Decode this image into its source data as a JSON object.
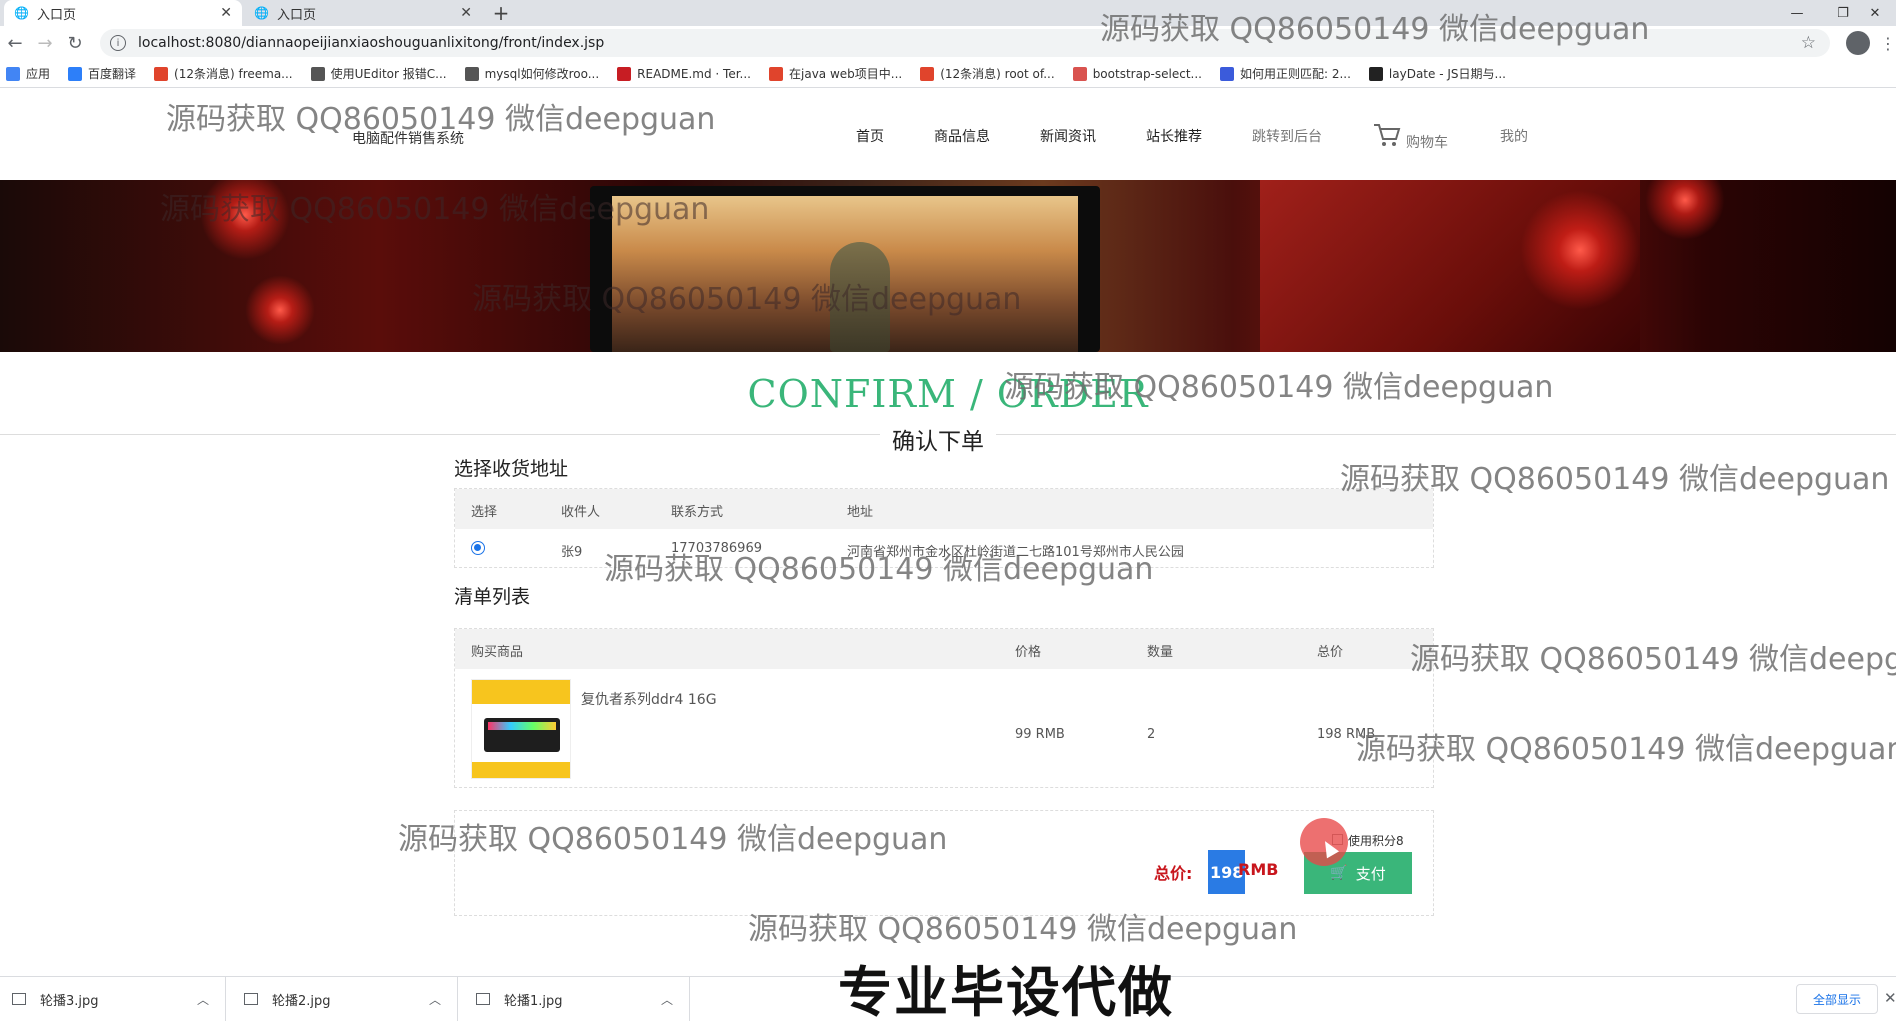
{
  "browser": {
    "tabs": [
      {
        "title": "入口页",
        "close": "✕"
      },
      {
        "title": "入口页",
        "close": "✕"
      }
    ],
    "new_tab": "+",
    "window_controls": {
      "minimize": "—",
      "restore": "❐",
      "close": "✕"
    },
    "url": "localhost:8080/diannaopeijianxiaoshouguanlixitong/front/index.jsp",
    "bookmarks": [
      {
        "label": "应用",
        "color": "#4285f4",
        "icon": "apps-icon"
      },
      {
        "label": "百度翻译",
        "color": "#2d7ff9",
        "icon": "translate-icon"
      },
      {
        "label": "(12条消息) freema...",
        "color": "#e0442c",
        "icon": "csdn-icon"
      },
      {
        "label": "使用UEditor 报错C...",
        "color": "#555555",
        "icon": "bookmark-icon"
      },
      {
        "label": "mysql如何修改roo...",
        "color": "#555555",
        "icon": "bookmark-icon"
      },
      {
        "label": "README.md · Ter...",
        "color": "#c71d23",
        "icon": "gitee-icon"
      },
      {
        "label": "在java web项目中...",
        "color": "#e0442c",
        "icon": "csdn-icon"
      },
      {
        "label": "(12条消息) root of...",
        "color": "#e0442c",
        "icon": "csdn-icon"
      },
      {
        "label": "bootstrap-select...",
        "color": "#d9534f",
        "icon": "jianshu-icon"
      },
      {
        "label": "如何用正则匹配: 2...",
        "color": "#3b5bdb",
        "icon": "baidu-icon"
      },
      {
        "label": "layDate - JS日期与...",
        "color": "#222222",
        "icon": "layui-icon"
      }
    ]
  },
  "site": {
    "logo_text": "电脑配件销售系统",
    "nav": [
      {
        "label": "首页",
        "muted": false
      },
      {
        "label": "商品信息",
        "muted": false
      },
      {
        "label": "新闻资讯",
        "muted": false
      },
      {
        "label": "站长推荐",
        "muted": false
      },
      {
        "label": "跳转到后台",
        "muted": true
      },
      {
        "label": "购物车",
        "muted": true
      },
      {
        "label": "我的",
        "muted": true
      }
    ]
  },
  "page": {
    "title_en": "CONFIRM / ORDER",
    "title_cn": "确认下单",
    "address_section": "选择收货地址",
    "address_headers": [
      "选择",
      "收件人",
      "联系方式",
      "地址"
    ],
    "address_rows": [
      {
        "selected": true,
        "name": "张9",
        "phone": "17703786969",
        "address": "河南省郑州市金水区杜岭街道二七路101号郑州市人民公园"
      }
    ],
    "list_section": "清单列表",
    "list_headers": [
      "购买商品",
      "价格",
      "数量",
      "总价"
    ],
    "items": [
      {
        "name": "复仇者系列ddr4 16G",
        "price": "99 RMB",
        "qty": "2",
        "total": "198 RMB"
      }
    ],
    "total_label": "总价:",
    "total_value": "198",
    "total_unit": "RMB",
    "use_points_label": "使用积分8",
    "pay_label": "支付"
  },
  "downloads": {
    "files": [
      "轮播3.jpg",
      "轮播2.jpg",
      "轮播1.jpg"
    ],
    "show_all": "全部显示",
    "close": "✕"
  },
  "overlay": {
    "watermark": "源码获取 QQ86050149 微信deepguan",
    "caption": "专业毕设代做"
  }
}
